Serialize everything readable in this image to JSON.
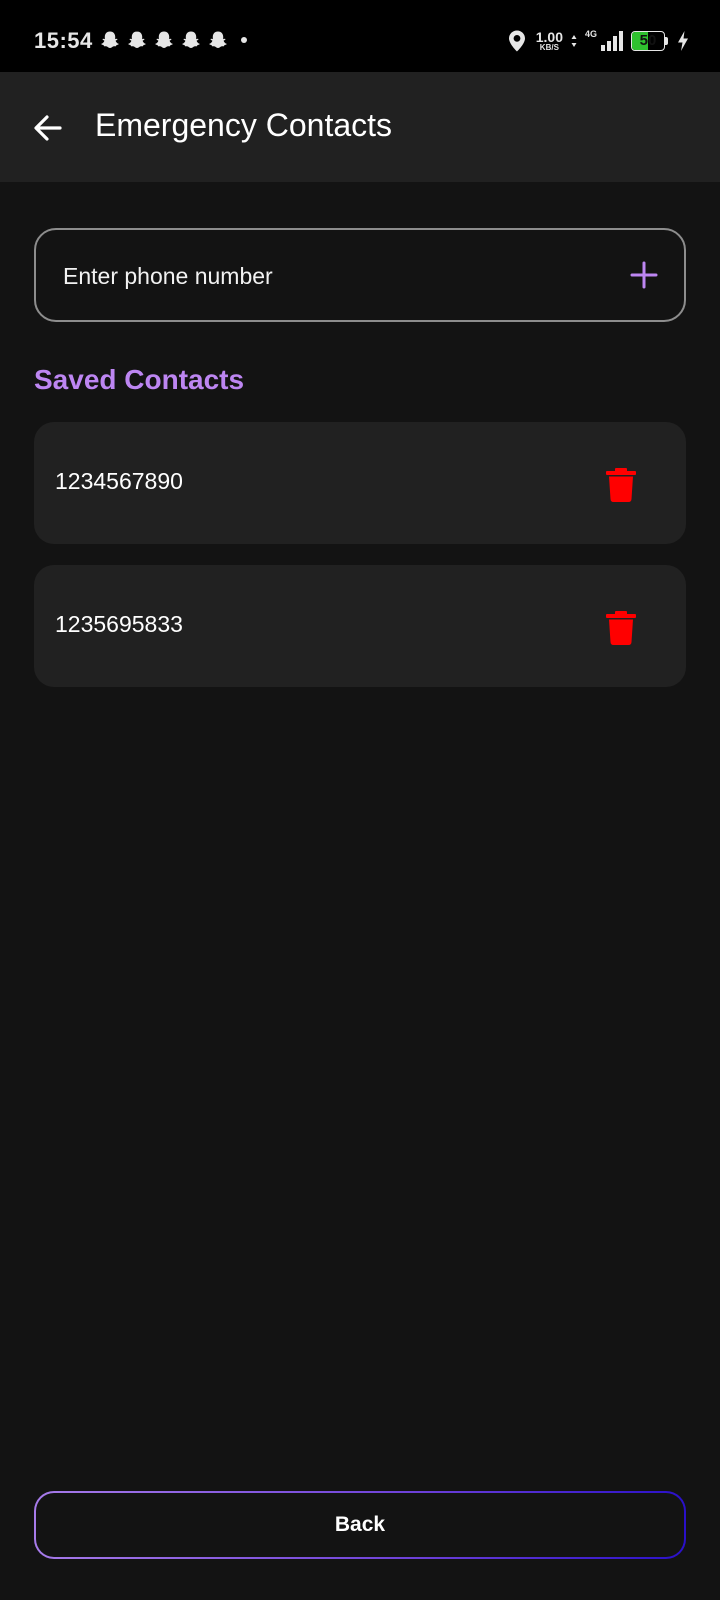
{
  "status_bar": {
    "time": "15:54",
    "notification_icons": [
      "snapchat-icon",
      "snapchat-icon",
      "snapchat-icon",
      "snapchat-icon",
      "snapchat-icon"
    ],
    "net_speed_value": "1.00",
    "net_speed_unit": "KB/S",
    "network_type": "4G",
    "battery_level": "50",
    "battery_fraction": 0.5,
    "battery_color": "#2fc12f"
  },
  "app_bar": {
    "title": "Emergency Contacts",
    "back_icon": "arrow-left-icon"
  },
  "phone_input": {
    "value": "",
    "placeholder": "Enter phone number",
    "add_icon": "plus-icon"
  },
  "saved_contacts": {
    "title": "Saved Contacts",
    "items": [
      {
        "number": "1234567890",
        "delete_icon": "trash-icon"
      },
      {
        "number": "1235695833",
        "delete_icon": "trash-icon"
      }
    ]
  },
  "back_button": {
    "label": "Back"
  },
  "colors": {
    "background": "#131313",
    "surface": "#212121",
    "accent": "#bd86f2",
    "delete": "#ff0000",
    "input_border": "#8d8d8d"
  }
}
